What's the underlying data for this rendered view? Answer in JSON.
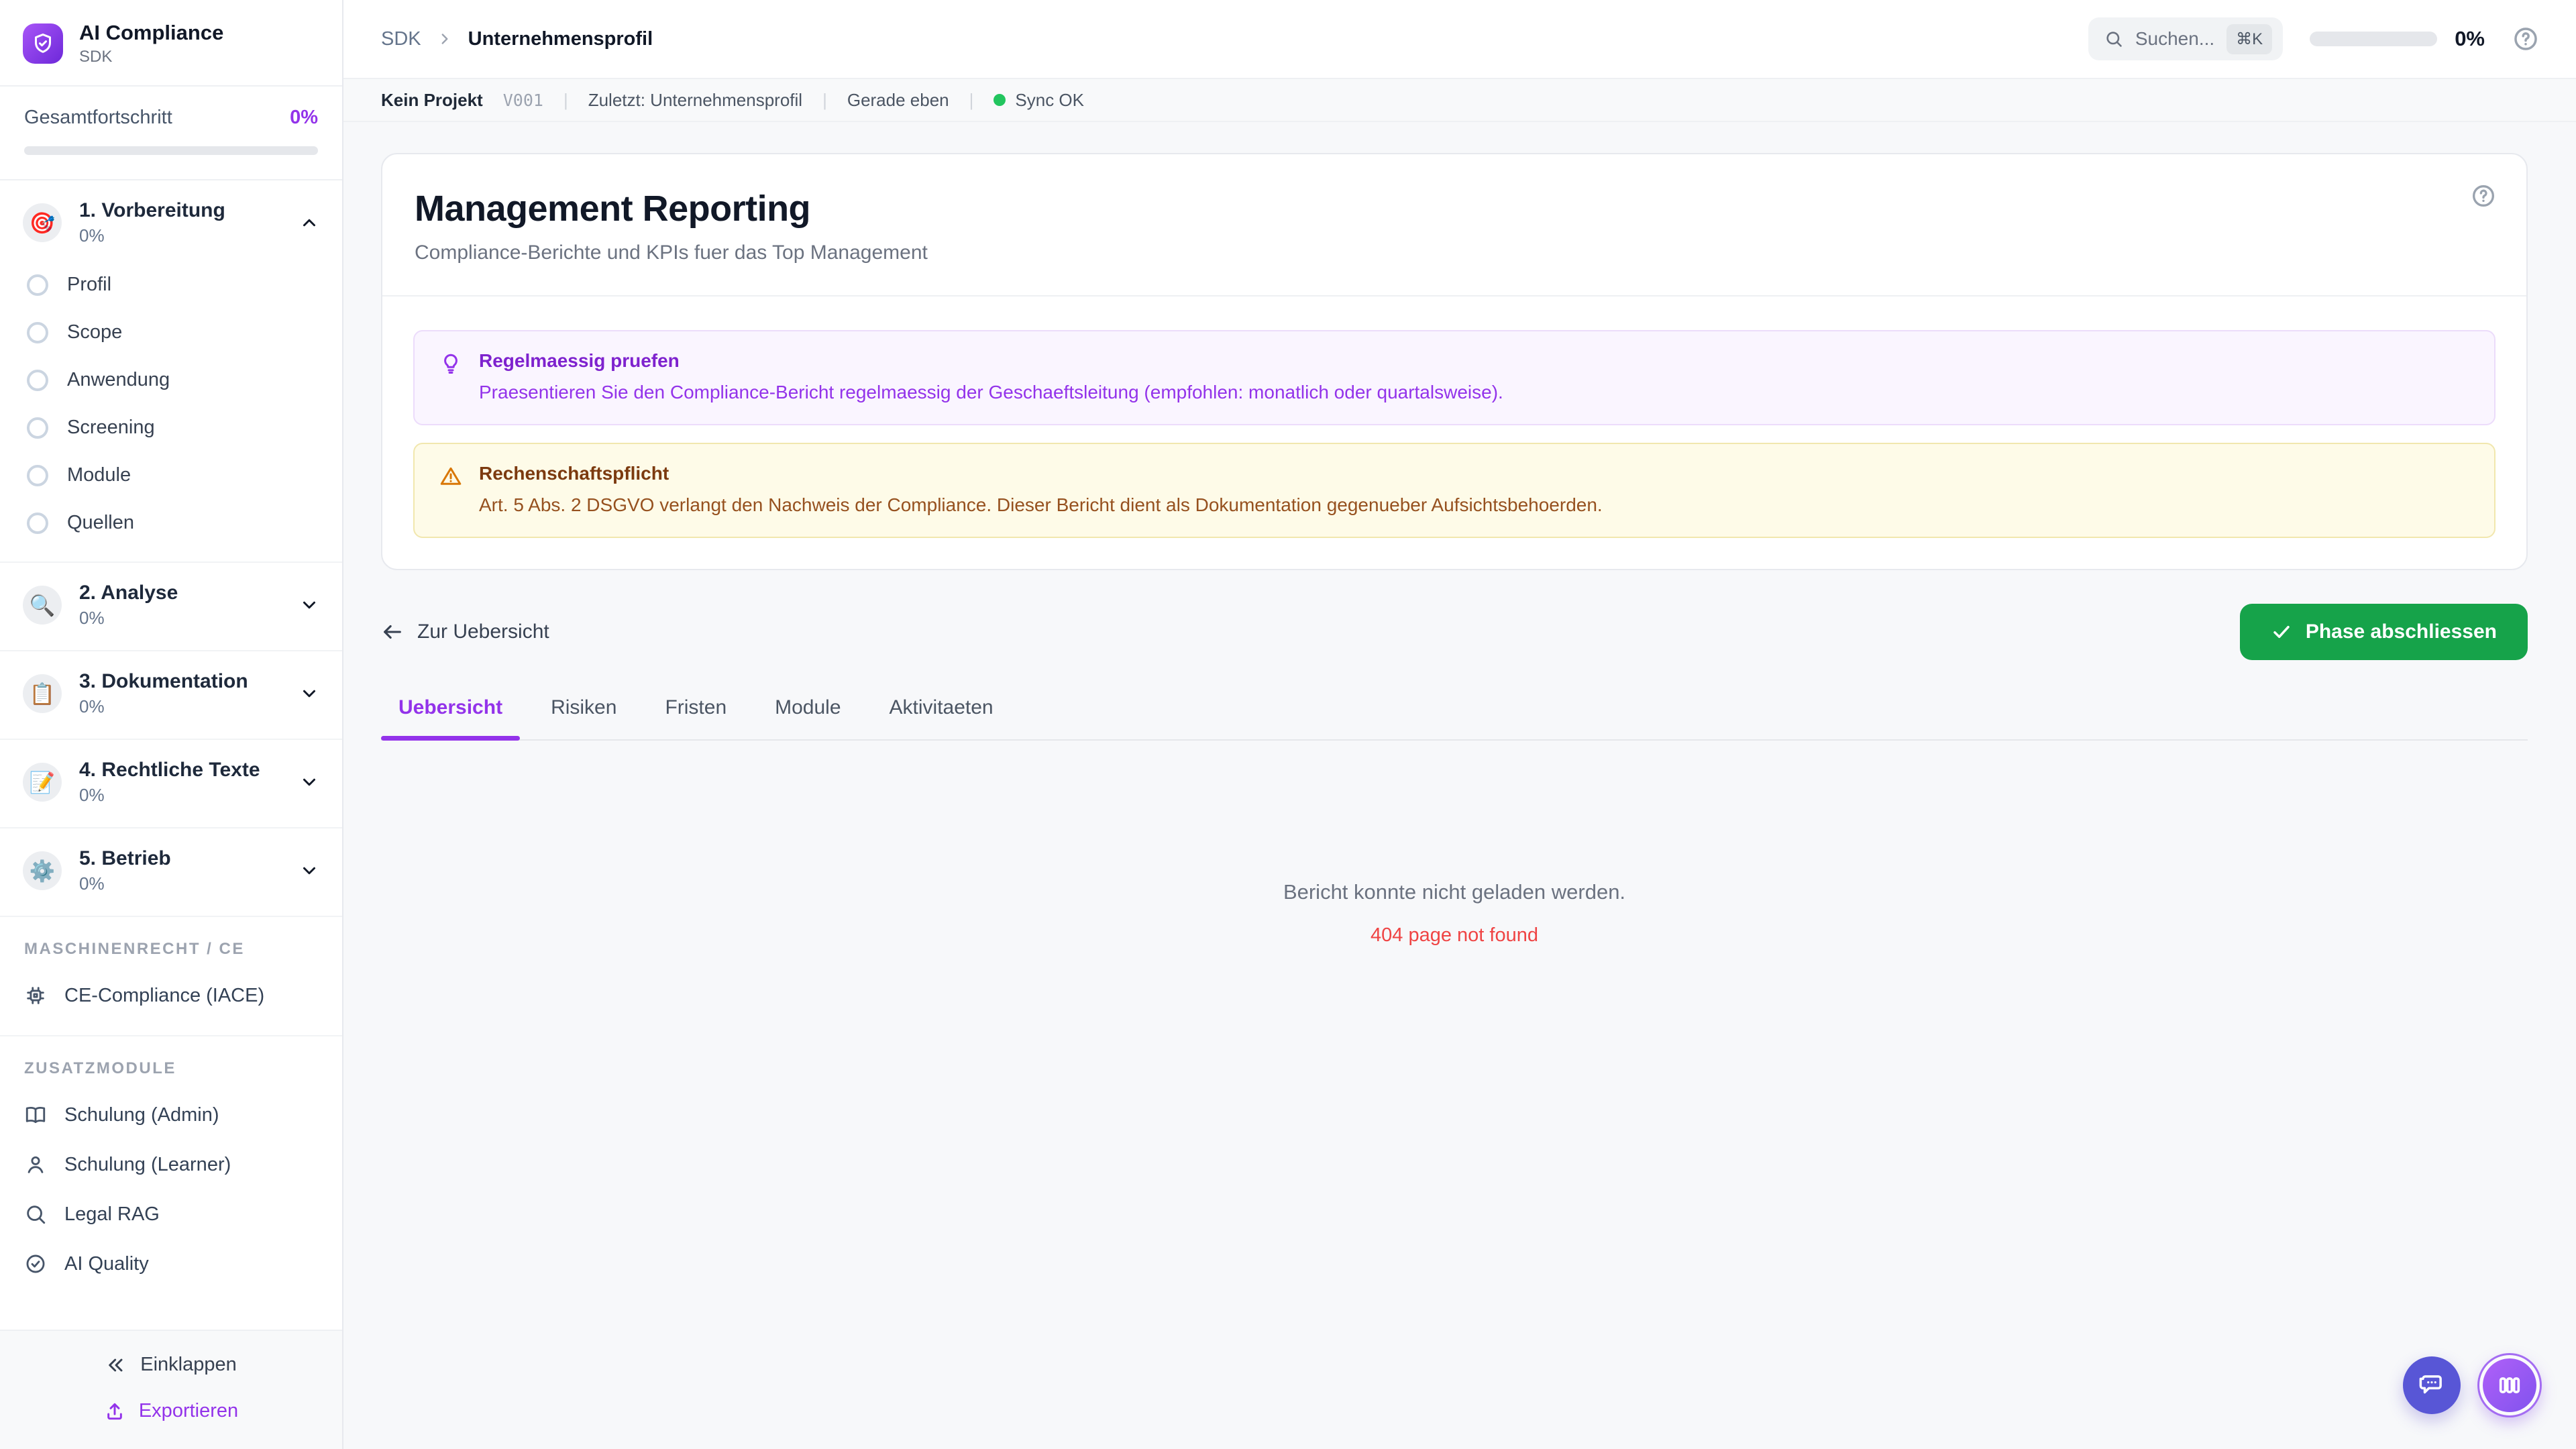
{
  "colors": {
    "accent_purple": "#9333ea",
    "success_green": "#16a34a",
    "error_red": "#ef4444",
    "sync_green": "#22c55e",
    "warning_amber": "#d97706",
    "logo_gradient_start": "#a855f7",
    "logo_gradient_end": "#6d28d9"
  },
  "sidebar": {
    "app_title": "AI Compliance",
    "app_subtitle": "SDK",
    "progress_label": "Gesamtfortschritt",
    "progress_value": "0%",
    "phases": [
      {
        "icon": "🎯",
        "label": "1. Vorbereitung",
        "percent": "0%",
        "expanded": true,
        "children": [
          "Profil",
          "Scope",
          "Anwendung",
          "Screening",
          "Module",
          "Quellen"
        ]
      },
      {
        "icon": "🔍",
        "label": "2. Analyse",
        "percent": "0%"
      },
      {
        "icon": "📋",
        "label": "3. Dokumentation",
        "percent": "0%"
      },
      {
        "icon": "📝",
        "label": "4. Rechtliche Texte",
        "percent": "0%"
      },
      {
        "icon": "⚙️",
        "label": "5. Betrieb",
        "percent": "0%"
      }
    ],
    "sections": [
      {
        "title": "MASCHINENRECHT / CE",
        "items": [
          {
            "icon": "chip-icon",
            "label": "CE-Compliance (IACE)"
          }
        ]
      },
      {
        "title": "ZUSATZMODULE",
        "items": [
          {
            "icon": "book-icon",
            "label": "Schulung (Admin)"
          },
          {
            "icon": "user-icon",
            "label": "Schulung (Learner)"
          },
          {
            "icon": "search-icon",
            "label": "Legal RAG"
          },
          {
            "icon": "check-circle-icon",
            "label": "AI Quality"
          }
        ]
      }
    ],
    "footer": {
      "collapse_label": "Einklappen",
      "export_label": "Exportieren"
    }
  },
  "header": {
    "breadcrumb_root": "SDK",
    "breadcrumb_current": "Unternehmensprofil",
    "search_placeholder": "Suchen...",
    "search_shortcut": "⌘K",
    "progress_value": "0%"
  },
  "statusbar": {
    "project": "Kein Projekt",
    "version": "V001",
    "last": "Zuletzt: Unternehmensprofil",
    "time": "Gerade eben",
    "sync": "Sync OK"
  },
  "main": {
    "title": "Management Reporting",
    "subtitle": "Compliance-Berichte und KPIs fuer das Top Management",
    "alerts": [
      {
        "type": "info",
        "icon": "lightbulb-icon",
        "title": "Regelmaessig pruefen",
        "body": "Praesentieren Sie den Compliance-Bericht regelmaessig der Geschaeftsleitung (empfohlen: monatlich oder quartalsweise)."
      },
      {
        "type": "warning",
        "icon": "warning-icon",
        "title": "Rechenschaftspflicht",
        "body": "Art. 5 Abs. 2 DSGVO verlangt den Nachweis der Compliance. Dieser Bericht dient als Dokumentation gegenueber Aufsichtsbehoerden."
      }
    ],
    "back_label": "Zur Uebersicht",
    "complete_button": "Phase abschliessen",
    "tabs": [
      "Uebersicht",
      "Risiken",
      "Fristen",
      "Module",
      "Aktivitaeten"
    ],
    "active_tab": "Uebersicht",
    "empty_state": {
      "message": "Bericht konnte nicht geladen werden.",
      "error": "404 page not found"
    }
  }
}
